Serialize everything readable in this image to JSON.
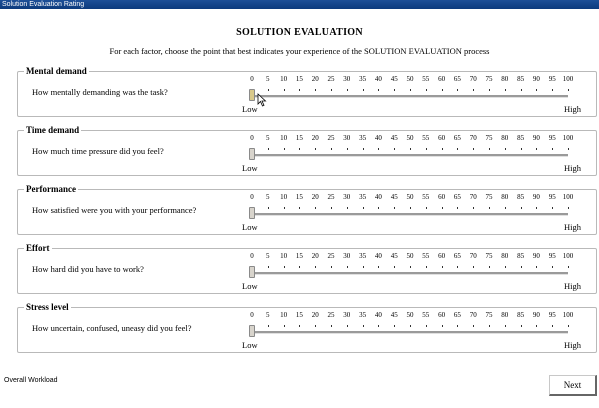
{
  "window": {
    "title": "Solution Evaluation Rating"
  },
  "heading": "SOLUTION EVALUATION",
  "instructions": "For each factor, choose the point that best indicates your experience of the SOLUTION EVALUATION process",
  "scale": {
    "ticks": [
      "0",
      "5",
      "10",
      "15",
      "20",
      "25",
      "30",
      "35",
      "40",
      "45",
      "50",
      "55",
      "60",
      "65",
      "70",
      "75",
      "80",
      "85",
      "90",
      "95",
      "100"
    ],
    "low_label": "Low",
    "high_label": "High"
  },
  "factors": [
    {
      "name": "Mental demand",
      "question": "How mentally demanding was the task?",
      "value": 0
    },
    {
      "name": "Time demand",
      "question": "How much time pressure did you feel?",
      "value": 0
    },
    {
      "name": "Performance",
      "question": "How satisfied were you with your performance?",
      "value": 0
    },
    {
      "name": "Effort",
      "question": "How hard did you have to work?",
      "value": 0
    },
    {
      "name": "Stress level",
      "question": "How uncertain, confused, uneasy did you feel?",
      "value": 0
    }
  ],
  "footer": {
    "overall_label": "Overall Workload",
    "next_label": "Next"
  },
  "icons": {
    "cursor": "mouse-pointer-icon"
  }
}
